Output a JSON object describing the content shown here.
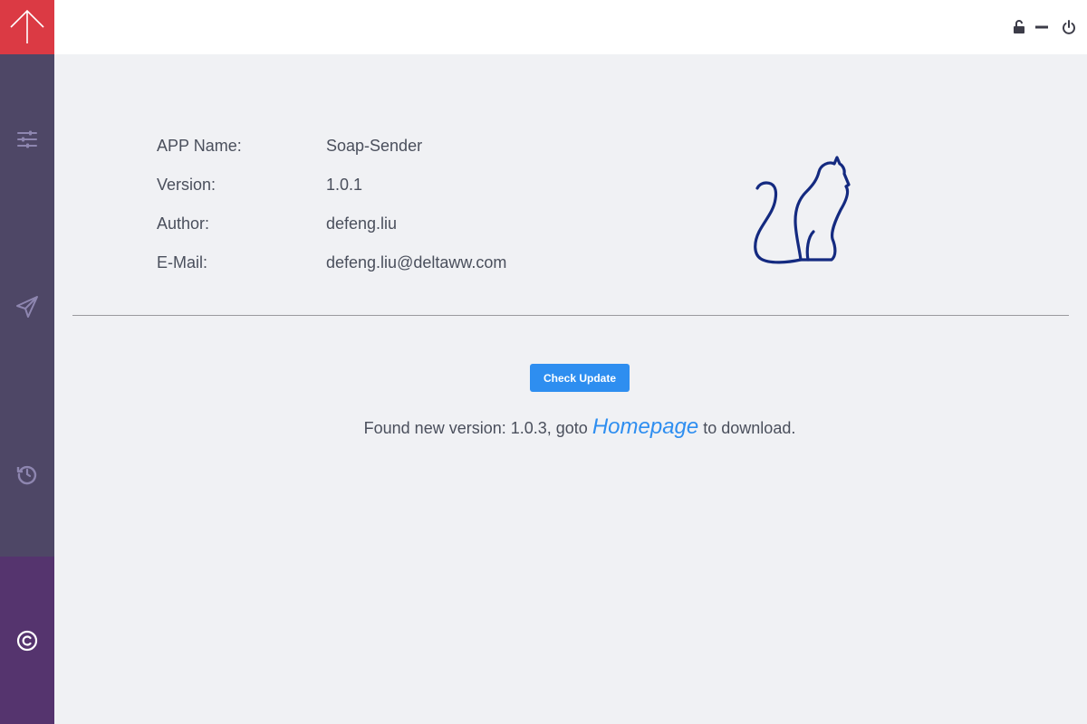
{
  "sidebar": {
    "logo_icon": "upload-arrow-icon",
    "items": [
      {
        "icon": "sliders-icon"
      },
      {
        "icon": "send-icon"
      },
      {
        "icon": "history-icon"
      },
      {
        "icon": "copyright-icon",
        "active": true
      }
    ]
  },
  "window_controls": [
    "unlock-icon",
    "minimize-icon",
    "power-icon"
  ],
  "about": {
    "rows": [
      {
        "label": "APP Name:",
        "value": "Soap-Sender"
      },
      {
        "label": "Version:",
        "value": "1.0.1"
      },
      {
        "label": "Author:",
        "value": "defeng.liu"
      },
      {
        "label": "E-Mail:",
        "value": "defeng.liu@deltaww.com"
      }
    ]
  },
  "update": {
    "button_label": "Check Update",
    "message_prefix": "Found new version: 1.0.3, goto",
    "link_text": "Homepage",
    "message_suffix": "to download."
  },
  "colors": {
    "accent": "#2e8ef0",
    "logo_bg": "#db3a44",
    "sidebar_bg": "#4e4766",
    "sidebar_active_bg": "#55346e",
    "main_bg": "#f0f1f4",
    "cat_stroke": "#142a80"
  }
}
